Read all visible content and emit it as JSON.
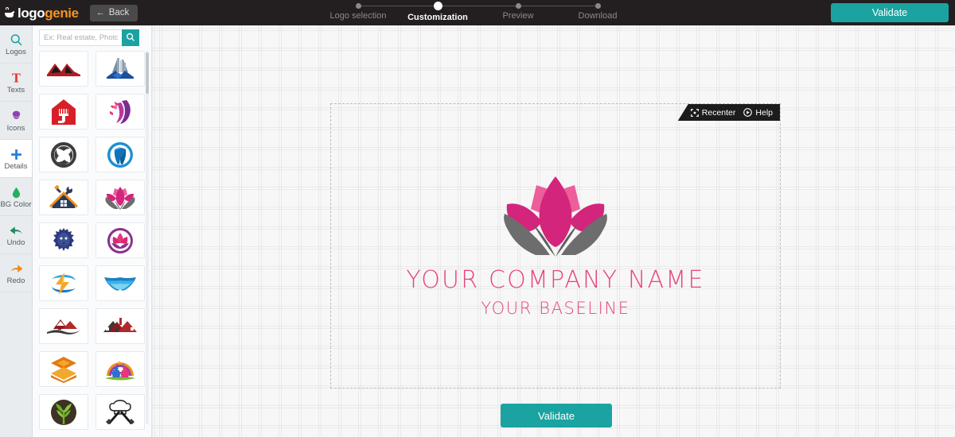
{
  "brand": {
    "word_one": "logo",
    "word_two": "genie",
    "icon": "genie-lamp-icon"
  },
  "topbar": {
    "back_label": "Back",
    "back_icon": "arrow-left-icon",
    "validate_label": "Validate",
    "accent_teal": "#1aa3a0",
    "accent_orange": "#f7941e",
    "bar_bg": "#231f20"
  },
  "steps": [
    {
      "label": "Logo selection",
      "active": false
    },
    {
      "label": "Customization",
      "active": true
    },
    {
      "label": "Preview",
      "active": false
    },
    {
      "label": "Download",
      "active": false
    }
  ],
  "sidebar": {
    "items": [
      {
        "label": "Logos",
        "icon": "search-icon",
        "color": "#1aa3a0",
        "active": false
      },
      {
        "label": "Texts",
        "icon": "text-t-icon",
        "color": "#e03b2f",
        "active": false
      },
      {
        "label": "Icons",
        "icon": "shapes-icon",
        "color": "#8e44ad",
        "active": false
      },
      {
        "label": "Details",
        "icon": "plus-icon",
        "color": "#2980d9",
        "active": true
      },
      {
        "label": "BG Color",
        "icon": "droplet-icon",
        "color": "#27ae60",
        "active": false
      },
      {
        "label": "Undo",
        "icon": "undo-arrow-icon",
        "color": "#1d8a5e",
        "active": false
      },
      {
        "label": "Redo",
        "icon": "redo-arrow-icon",
        "color": "#f08a1e",
        "active": false
      }
    ]
  },
  "search": {
    "placeholder": "Ex: Real estate, Photo...",
    "value": "",
    "button_icon": "search-icon"
  },
  "thumbnails": [
    {
      "name": "roof-mountain-logo",
      "icon": "roof-mountain-icon"
    },
    {
      "name": "city-building-logo",
      "icon": "building-icon"
    },
    {
      "name": "house-paint-logo",
      "icon": "house-brush-icon"
    },
    {
      "name": "hair-flower-logo",
      "icon": "hair-flower-icon"
    },
    {
      "name": "lion-swirl-logo",
      "icon": "lion-swirl-icon"
    },
    {
      "name": "tooth-dental-logo",
      "icon": "tooth-icon"
    },
    {
      "name": "house-tools-logo",
      "icon": "house-tools-icon"
    },
    {
      "name": "lotus-hands-logo",
      "icon": "lotus-hands-icon"
    },
    {
      "name": "lion-head-logo",
      "icon": "lion-head-icon"
    },
    {
      "name": "lotus-circle-logo",
      "icon": "lotus-circle-icon"
    },
    {
      "name": "lightning-bolt-logo",
      "icon": "lightning-icon"
    },
    {
      "name": "wings-logo",
      "icon": "wings-icon"
    },
    {
      "name": "red-roof-wave-logo",
      "icon": "red-roof-wave-icon"
    },
    {
      "name": "red-roof-house-logo",
      "icon": "red-roof-house-icon"
    },
    {
      "name": "orange-layers-logo",
      "icon": "layers-icon"
    },
    {
      "name": "children-rainbow-logo",
      "icon": "children-rainbow-icon"
    },
    {
      "name": "green-tree-logo",
      "icon": "tree-circle-icon"
    },
    {
      "name": "chef-knives-logo",
      "icon": "chef-hat-knives-icon"
    }
  ],
  "canvas": {
    "toolbar": {
      "recenter_label": "Recenter",
      "recenter_icon": "recenter-crosshair-icon",
      "help_label": "Help",
      "help_icon": "play-circle-icon"
    },
    "logo": {
      "icon": "lotus-hands-icon",
      "petal_color": "#d4257c",
      "petal_light_color": "#ea6ba3",
      "hands_color": "#6d6d6d"
    },
    "company_name": "YOUR COMPANY NAME",
    "baseline": "YOUR BASELINE",
    "text_color": "#e8447e"
  },
  "footer": {
    "validate_label": "Validate"
  }
}
